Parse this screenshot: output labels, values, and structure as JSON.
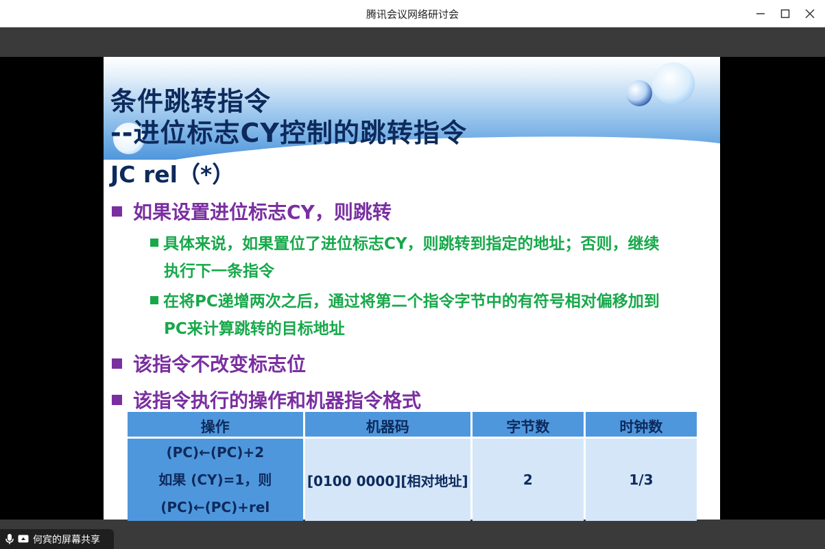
{
  "window": {
    "title": "腾讯会议网络研讨会"
  },
  "slide": {
    "title": "条件跳转指令",
    "subtitle": "--进位标志CY控制的跳转指令",
    "instruction": "JC rel（*）",
    "bullets": [
      {
        "text": "如果设置进位标志CY，则跳转",
        "sub": [
          {
            "line1": "具体来说，如果置位了进位标志CY，则跳转到指定的地址；否则，继续",
            "line2": "执行下一条指令"
          },
          {
            "line1": "在将PC递增两次之后，通过将第二个指令字节中的有符号相对偏移加到",
            "line2": "PC来计算跳转的目标地址"
          }
        ]
      },
      {
        "text": "该指令不改变标志位"
      },
      {
        "text": "该指令执行的操作和机器指令格式"
      }
    ],
    "table": {
      "headers": [
        "操作",
        "机器码",
        "字节数",
        "时钟数"
      ],
      "row": {
        "op_lines": [
          "(PC)←(PC)+2",
          "如果 (CY)=1，则",
          "(PC)←(PC)+rel"
        ],
        "machine_code": "[0100 0000][相对地址]",
        "bytes": "2",
        "clocks": "1/3"
      }
    }
  },
  "status": {
    "share_label": "何宾的屏幕共享"
  },
  "colors": {
    "title_navy": "#0d2a5c",
    "bullet_purple": "#7a2fa0",
    "sub_green": "#17a84a",
    "table_header_blue": "#4f97dc",
    "table_cell_light": "#d5e6f8"
  }
}
